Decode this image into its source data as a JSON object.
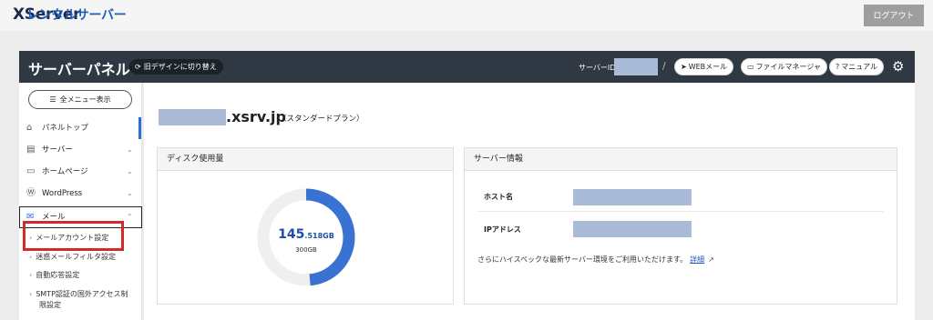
{
  "brand": {
    "name": "XServer",
    "product": "レンタルサーバー"
  },
  "topbar": {
    "logout_label": "ログアウト"
  },
  "header": {
    "title": "サーバーパネル",
    "old_design_label": "旧デザインに切り替え",
    "server_id_label": "サーバーID",
    "separator": "/",
    "buttons": [
      {
        "label": "WEBメール",
        "icon": "paper-plane-icon"
      },
      {
        "label": "ファイルマネージャ",
        "icon": "folder-icon"
      },
      {
        "label": "マニュアル",
        "icon": "question-icon"
      }
    ],
    "settings_icon": "gear-icon"
  },
  "sidebar": {
    "all_menu_label": "全メニュー表示",
    "items": [
      {
        "label": "パネルトップ",
        "icon": "home-icon",
        "active": true
      },
      {
        "label": "サーバー",
        "icon": "server-icon"
      },
      {
        "label": "ホームページ",
        "icon": "browser-icon"
      },
      {
        "label": "WordPress",
        "icon": "wordpress-icon"
      },
      {
        "label": "メール",
        "icon": "mail-icon",
        "expanded": true
      }
    ],
    "mail_subitems": [
      {
        "label": "メールアカウント設定"
      },
      {
        "label": "迷惑メールフィルタ設定"
      },
      {
        "label": "自動応答設定"
      },
      {
        "label": "SMTP認証の国外アクセス制"
      },
      {
        "label": "限設定"
      }
    ]
  },
  "main": {
    "domain": ".xsrv.jp",
    "plan": "（スタンダードプラン）",
    "disk": {
      "title": "ディスク使用量",
      "used_main": "145",
      "used_decimal": ".518GB",
      "total": "300GB",
      "used_fraction": 0.4851,
      "ring_color": "#3a72d4",
      "track_color": "#efefef"
    },
    "server_info": {
      "title": "サーバー情報",
      "host_label": "ホスト名",
      "ip_label": "IPアドレス",
      "note": "さらにハイスペックな最新サーバー環境をご利用いただけます。",
      "link_label": "詳細"
    }
  }
}
